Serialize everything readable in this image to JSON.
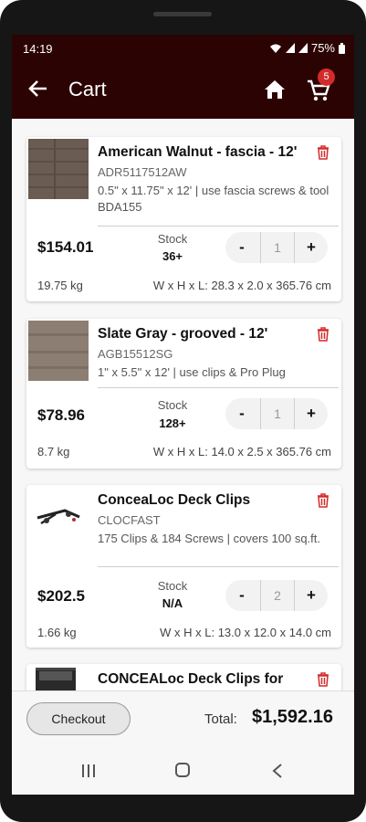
{
  "status": {
    "time": "14:19",
    "battery": "75%"
  },
  "header": {
    "title": "Cart",
    "cart_count": "5"
  },
  "items": [
    {
      "name": "American Walnut - fascia - 12'",
      "sku": "ADR5117512AW",
      "description": "0.5\" x 11.75\" x 12' | use fascia screws & tool BDA155",
      "price": "$154.01",
      "stock_label": "Stock",
      "stock": "36+",
      "qty": "1",
      "minus": "-",
      "plus": "+",
      "weight": "19.75 kg",
      "dimensions": "W x H x L: 28.3 x 2.0 x 365.76 cm"
    },
    {
      "name": "Slate Gray - grooved - 12'",
      "sku": "AGB15512SG",
      "description": "1\" x 5.5\" x 12' | use  clips & Pro Plug",
      "price": "$78.96",
      "stock_label": "Stock",
      "stock": "128+",
      "qty": "1",
      "minus": "-",
      "plus": "+",
      "weight": "8.7 kg",
      "dimensions": "W x H x L: 14.0 x 2.5 x 365.76 cm"
    },
    {
      "name": "ConceaLoc Deck Clips",
      "sku": "CLOCFAST",
      "description": "175 Clips & 184 Screws | covers 100 sq.ft.",
      "price": "$202.5",
      "stock_label": "Stock",
      "stock": "N/A",
      "qty": "2",
      "minus": "-",
      "plus": "+",
      "weight": "1.66 kg",
      "dimensions": "W x H x L: 13.0 x 12.0 x 14.0 cm"
    },
    {
      "name": "CONCEALoc Deck Clips for"
    }
  ],
  "footer": {
    "checkout_label": "Checkout",
    "total_label": "Total:",
    "total_value": "$1,592.16"
  },
  "colors": {
    "header_bg": "#2c0303",
    "trash": "#d32b2b",
    "badge": "#d32b2b"
  }
}
